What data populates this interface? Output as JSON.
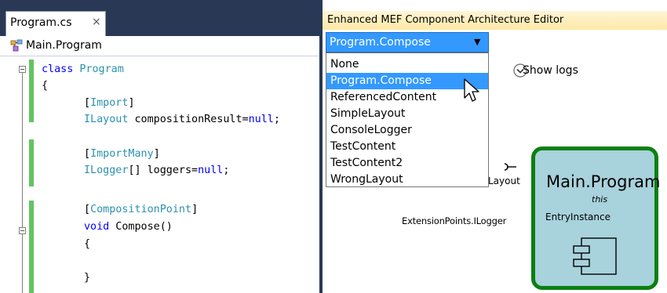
{
  "editor": {
    "tab_label": "Program.cs",
    "tab_close": "×",
    "nav_label": "Main.Program",
    "code": {
      "l1_kw": "class",
      "l1_name": " Program",
      "l2": "{",
      "l3_attr": "Import",
      "l4_type": "ILayout",
      "l4_rest": " compositionResult=",
      "l4_null": "null",
      "l4_end": ";",
      "l6_attr": "ImportMany",
      "l7_type": "ILogger",
      "l7_rest": "[] loggers=",
      "l7_null": "null",
      "l7_end": ";",
      "l9_attr": "CompositionPoint",
      "l10_kw": "void",
      "l10_rest": " Compose()",
      "l11": "{",
      "l13": "}"
    }
  },
  "designer": {
    "title": "Enhanced MEF Component Architecture Editor",
    "combo": {
      "selected": "Program.Compose"
    },
    "dropdown": [
      "None",
      "Program.Compose",
      "ReferencedContent",
      "SimpleLayout",
      "ConsoleLogger",
      "TestContent",
      "TestContent2",
      "WrongLayout"
    ],
    "show_logs": "Show logs",
    "port_layout_label": "Layout",
    "port_logger_label": "ExtensionPoints.ILogger",
    "component": {
      "title": "Main.Program",
      "subtitle": "this",
      "entry": "EntryInstance"
    }
  },
  "colors": {
    "selection": "#3399ff",
    "component_border": "#0b8011",
    "component_fill": "#a8d2dc",
    "change_marker": "#62c462"
  }
}
